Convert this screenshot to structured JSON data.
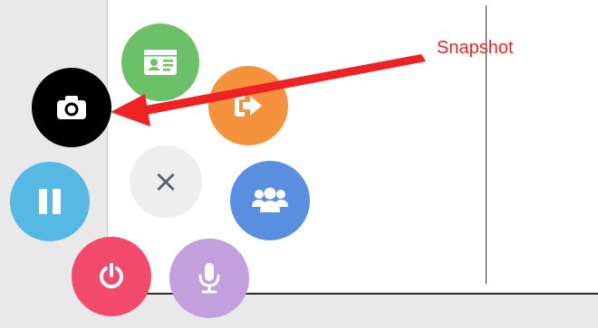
{
  "annotation": {
    "text": "Snapshot",
    "color": "#ee2222"
  },
  "fab_menu": {
    "close_icon": "×",
    "buttons": [
      {
        "name": "contact-card",
        "icon": "id-card-icon",
        "color": "#6cc06a"
      },
      {
        "name": "snapshot",
        "icon": "camera-icon",
        "color": "#000000"
      },
      {
        "name": "exit",
        "icon": "sign-out-icon",
        "color": "#f5923e"
      },
      {
        "name": "close",
        "icon": "close-icon",
        "color": "#eeeeee"
      },
      {
        "name": "participants",
        "icon": "users-icon",
        "color": "#5a8fe0"
      },
      {
        "name": "pause",
        "icon": "pause-icon",
        "color": "#55b9e3"
      },
      {
        "name": "power",
        "icon": "power-icon",
        "color": "#f14a6b"
      },
      {
        "name": "microphone",
        "icon": "microphone-icon",
        "color": "#c39fdd"
      }
    ]
  }
}
